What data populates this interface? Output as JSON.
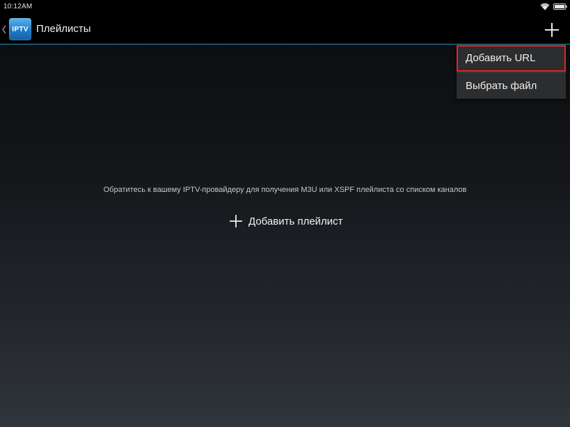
{
  "status_bar": {
    "time": "10:12AM",
    "icons": [
      "wifi-icon",
      "battery-icon"
    ]
  },
  "action_bar": {
    "app_icon_text": "IPTV",
    "title": "Плейлисты",
    "add_icon": "plus-icon",
    "accent_color": "#2f8fb8"
  },
  "menu": {
    "items": [
      {
        "label": "Добавить URL",
        "highlighted": true
      },
      {
        "label": "Выбрать файл",
        "highlighted": false
      }
    ],
    "highlight_color": "#e0262a"
  },
  "main": {
    "hint": "Обратитесь к вашему IPTV-провайдеру для получения M3U или XSPF плейлиста со списком каналов",
    "add_playlist_label": "Добавить плейлист"
  }
}
